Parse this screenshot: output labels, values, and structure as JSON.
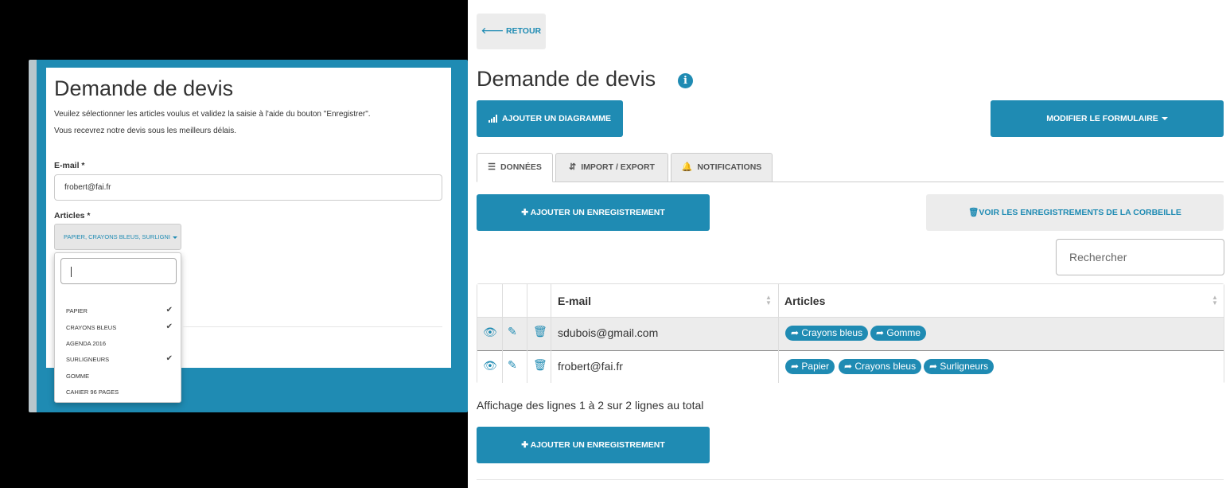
{
  "form_preview": {
    "title": "Demande de devis",
    "intro_line1": "Veuilez sélectionner les articles voulus et validez la saisie à l'aide du bouton \"Enregistrer\".",
    "intro_line2": "Vous recevrez notre devis sous les meilleurs délais.",
    "email_label": "E-mail *",
    "email_value": "frobert@fai.fr",
    "articles_label": "Articles *",
    "multiselect_value": "PAPIER, CRAYONS BLEUS, SURLIGNI",
    "options": [
      {
        "label": "PAPIER",
        "checked": true
      },
      {
        "label": "CRAYONS BLEUS",
        "checked": true
      },
      {
        "label": "AGENDA 2016",
        "checked": false
      },
      {
        "label": "SURLIGNEURS",
        "checked": true
      },
      {
        "label": "GOMME",
        "checked": false
      },
      {
        "label": "CAHIER 96 PAGES",
        "checked": false
      }
    ]
  },
  "header": {
    "back_label": "RETOUR",
    "back_icon": "arrow-left-icon",
    "title": "Demande de devis",
    "info_icon": "info-circle-icon"
  },
  "toolbar": {
    "add_chart_label": "AJOUTER UN DIAGRAMME",
    "modify_form_label": "MODIFIER LE FORMULAIRE"
  },
  "tabs": [
    {
      "label": "DONNÉES",
      "icon": "list-icon",
      "active": true
    },
    {
      "label": "IMPORT / EXPORT",
      "icon": "import-export-icon",
      "active": false
    },
    {
      "label": "NOTIFICATIONS",
      "icon": "bell-icon",
      "active": false
    }
  ],
  "actions": {
    "add_record_label": "AJOUTER UN ENREGISTREMENT",
    "trash_label": "VOIR LES ENREGISTREMENTS DE LA CORBEILLE"
  },
  "search": {
    "placeholder": "Rechercher"
  },
  "table": {
    "columns": [
      "E-mail",
      "Articles"
    ],
    "rows": [
      {
        "email": "sdubois@gmail.com",
        "articles": [
          "Crayons bleus",
          "Gomme"
        ]
      },
      {
        "email": "frobert@fai.fr",
        "articles": [
          "Papier",
          "Crayons bleus",
          "Surligneurs"
        ]
      }
    ]
  },
  "summary": "Affichage des lignes 1 à 2 sur 2 lignes au total",
  "colors": {
    "accent": "#1f8bb3",
    "light_gray": "#ececec"
  }
}
